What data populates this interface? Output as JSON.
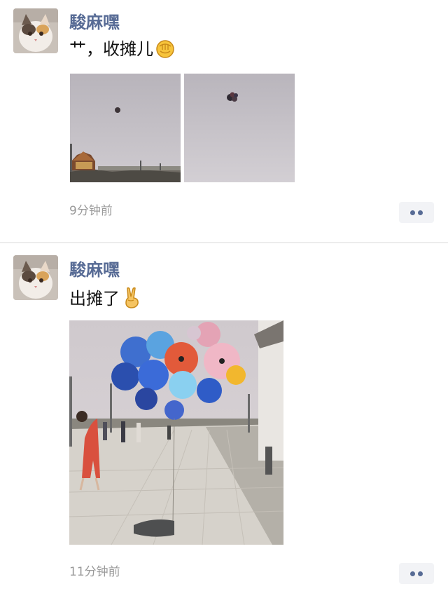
{
  "posts": [
    {
      "username": "駿麻嘿",
      "text": "艹，收摊儿",
      "emoji": "fist-emoji",
      "time": "9分钟前",
      "images": [
        "balloon-in-sky-photo-wide",
        "balloon-in-sky-photo-close"
      ]
    },
    {
      "username": "駿麻嘿",
      "text": "出摊了",
      "emoji": "victory-hand-emoji",
      "time": "11分钟前",
      "images": [
        "balloon-vendor-photo"
      ]
    }
  ],
  "colors": {
    "username": "#576b95",
    "timestamp": "#9a9a9a",
    "more_button_bg": "#f2f3f6"
  }
}
